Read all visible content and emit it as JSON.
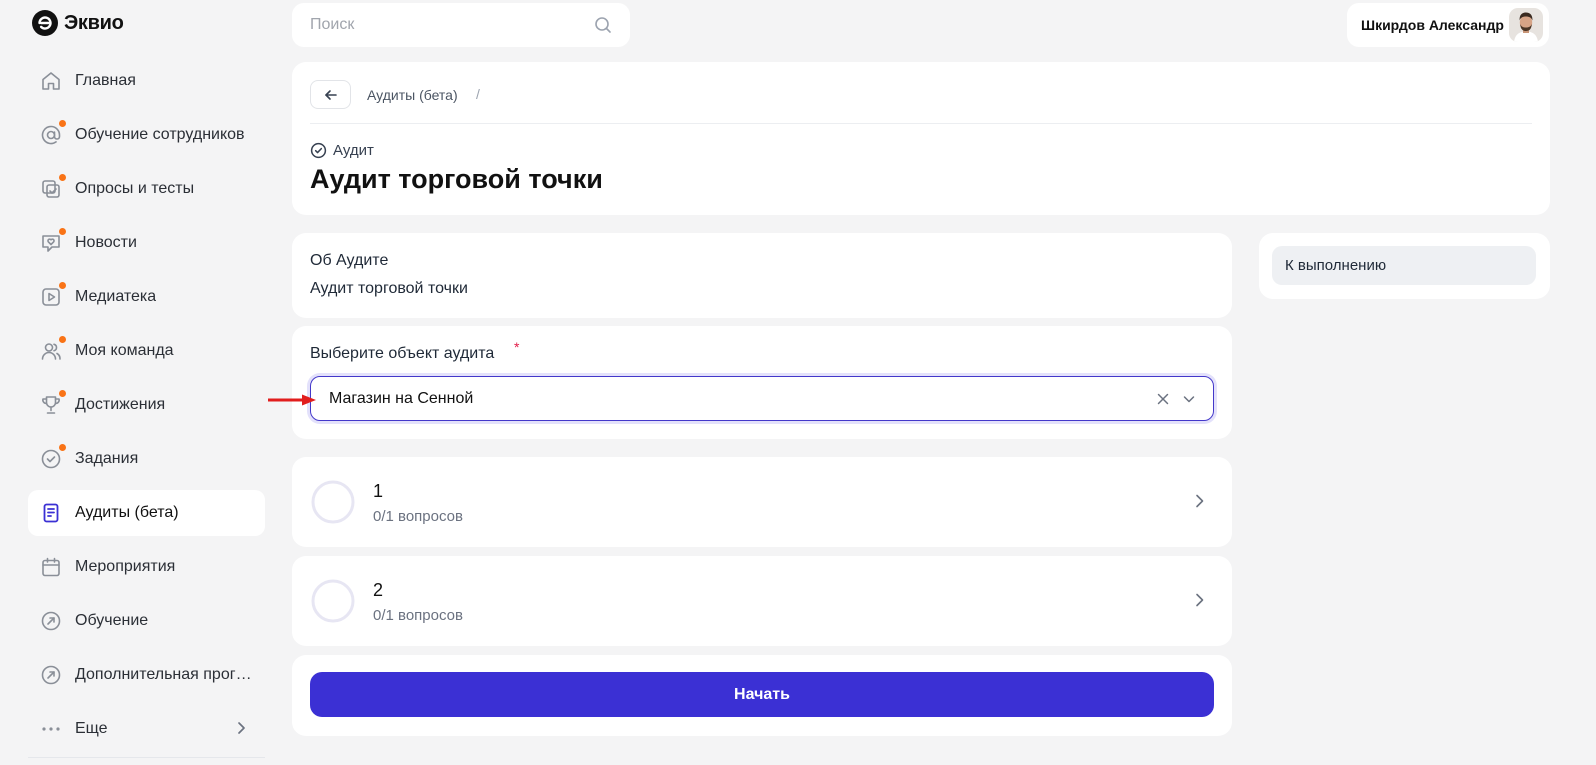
{
  "app": {
    "name": "Эквио"
  },
  "search": {
    "placeholder": "Поиск"
  },
  "user": {
    "name": "Шкирдов Александр"
  },
  "sidebar": {
    "items": [
      {
        "label": "Главная",
        "icon": "home-icon",
        "badge": false,
        "active": false
      },
      {
        "label": "Обучение сотрудников",
        "icon": "at-icon",
        "badge": true,
        "active": false
      },
      {
        "label": "Опросы и тесты",
        "icon": "checklist-icon",
        "badge": true,
        "active": false
      },
      {
        "label": "Новости",
        "icon": "heart-chat-icon",
        "badge": true,
        "active": false
      },
      {
        "label": "Медиатека",
        "icon": "play-icon",
        "badge": true,
        "active": false
      },
      {
        "label": "Моя команда",
        "icon": "team-icon",
        "badge": true,
        "active": false
      },
      {
        "label": "Достижения",
        "icon": "trophy-icon",
        "badge": true,
        "active": false
      },
      {
        "label": "Задания",
        "icon": "check-circle-icon",
        "badge": true,
        "active": false
      },
      {
        "label": "Аудиты (бета)",
        "icon": "document-icon",
        "badge": false,
        "active": true
      },
      {
        "label": "Мероприятия",
        "icon": "calendar-icon",
        "badge": false,
        "active": false
      },
      {
        "label": "Обучение",
        "icon": "compass-icon",
        "badge": false,
        "active": false
      },
      {
        "label": "Дополнительная программа",
        "icon": "compass-icon",
        "badge": false,
        "active": false
      },
      {
        "label": "Еще",
        "icon": "more-icon",
        "badge": false,
        "active": false
      }
    ]
  },
  "header": {
    "breadcrumb": "Аудиты (бета)",
    "breadcrumb_separator": "/",
    "type_label": "Аудит",
    "title": "Аудит торговой точки"
  },
  "about": {
    "title": "Об Аудите",
    "text": "Аудит торговой точки"
  },
  "status": {
    "label": "К выполнению"
  },
  "select": {
    "label": "Выберите объект аудита",
    "required_mark": "*",
    "value": "Магазин на Сенной"
  },
  "sections": [
    {
      "name": "1",
      "progress": "0/1 вопросов"
    },
    {
      "name": "2",
      "progress": "0/1 вопросов"
    }
  ],
  "actions": {
    "start_label": "Начать"
  },
  "colors": {
    "accent": "#3b30d4",
    "badge": "#f97316",
    "required": "#e11d48",
    "annotation_arrow": "#e11d1d"
  }
}
